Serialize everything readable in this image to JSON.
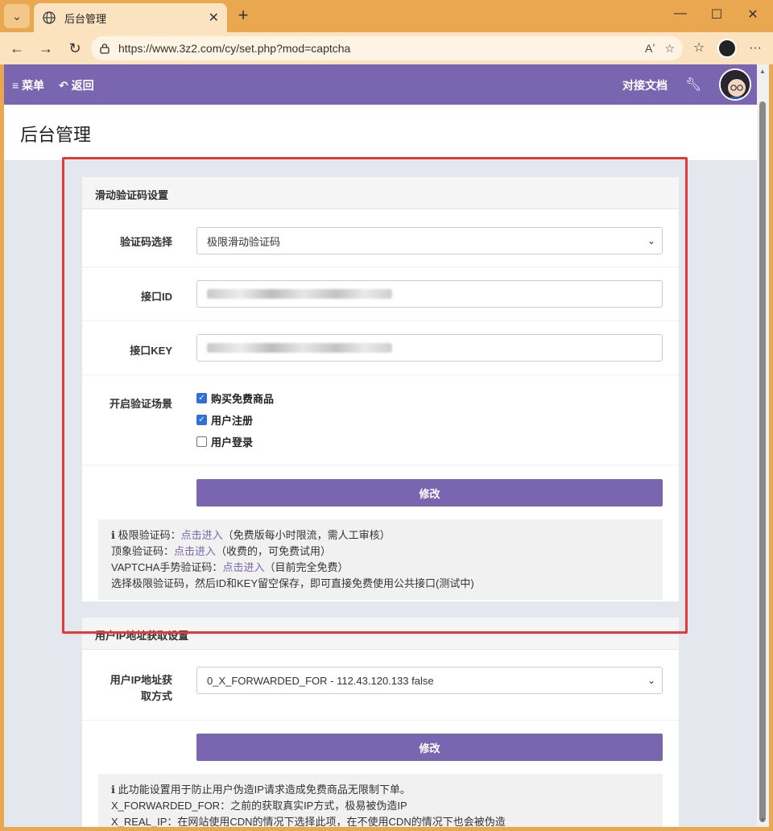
{
  "browser": {
    "tab_title": "后台管理",
    "url": "https://www.3z2.com/cy/set.php?mod=captcha",
    "icons": {
      "tab_list": "chevron-down-icon",
      "new_tab": "plus-icon",
      "minimize": "minimize-icon",
      "maximize": "maximize-icon",
      "close": "close-icon",
      "back": "back-arrow-icon",
      "forward": "forward-arrow-icon",
      "reload": "reload-icon",
      "read_aloud": "read-aloud-icon",
      "favorite": "star-icon",
      "favorites": "favorites-icon",
      "more": "more-icon"
    }
  },
  "header": {
    "menu_label": "菜单",
    "back_label": "返回",
    "docs_label": "对接文档",
    "accent": "#7a66b0"
  },
  "page": {
    "title": "后台管理"
  },
  "captcha_panel": {
    "title": "滑动验证码设置",
    "captcha_select_label": "验证码选择",
    "captcha_select_value": "极限滑动验证码",
    "api_id_label": "接口ID",
    "api_key_label": "接口KEY",
    "scenario_label": "开启验证场景",
    "scenarios": [
      {
        "label": "购买免费商品",
        "checked": true
      },
      {
        "label": "用户注册",
        "checked": true
      },
      {
        "label": "用户登录",
        "checked": false
      }
    ],
    "submit_label": "修改",
    "notes": {
      "line1_prefix": "极限验证码：",
      "line1_link": "点击进入",
      "line1_suffix": "（免费版每小时限流，需人工审核）",
      "line2_prefix": "顶象验证码：",
      "line2_link": "点击进入",
      "line2_suffix": "（收费的，可免费试用）",
      "line3_prefix": "VAPTCHA手势验证码：",
      "line3_link": "点击进入",
      "line3_suffix": "（目前完全免费）",
      "line4": "选择极限验证码，然后ID和KEY留空保存，即可直接免费使用公共接口(测试中)"
    }
  },
  "ip_panel": {
    "title": "用户IP地址获取设置",
    "method_label_line1": "用户IP地址获",
    "method_label_line2": "取方式",
    "method_value": "0_X_FORWARDED_FOR - 112.43.120.133 false",
    "submit_label": "修改",
    "notes": {
      "line1": "此功能设置用于防止用户伪造IP请求造成免费商品无限制下单。",
      "line2": "X_FORWARDED_FOR：之前的获取真实IP方式，极易被伪造IP",
      "line3": "X_REAL_IP：在网站使用CDN的情况下选择此项，在不使用CDN的情况下也会被伪造"
    }
  },
  "highlight_color": "#e53935"
}
